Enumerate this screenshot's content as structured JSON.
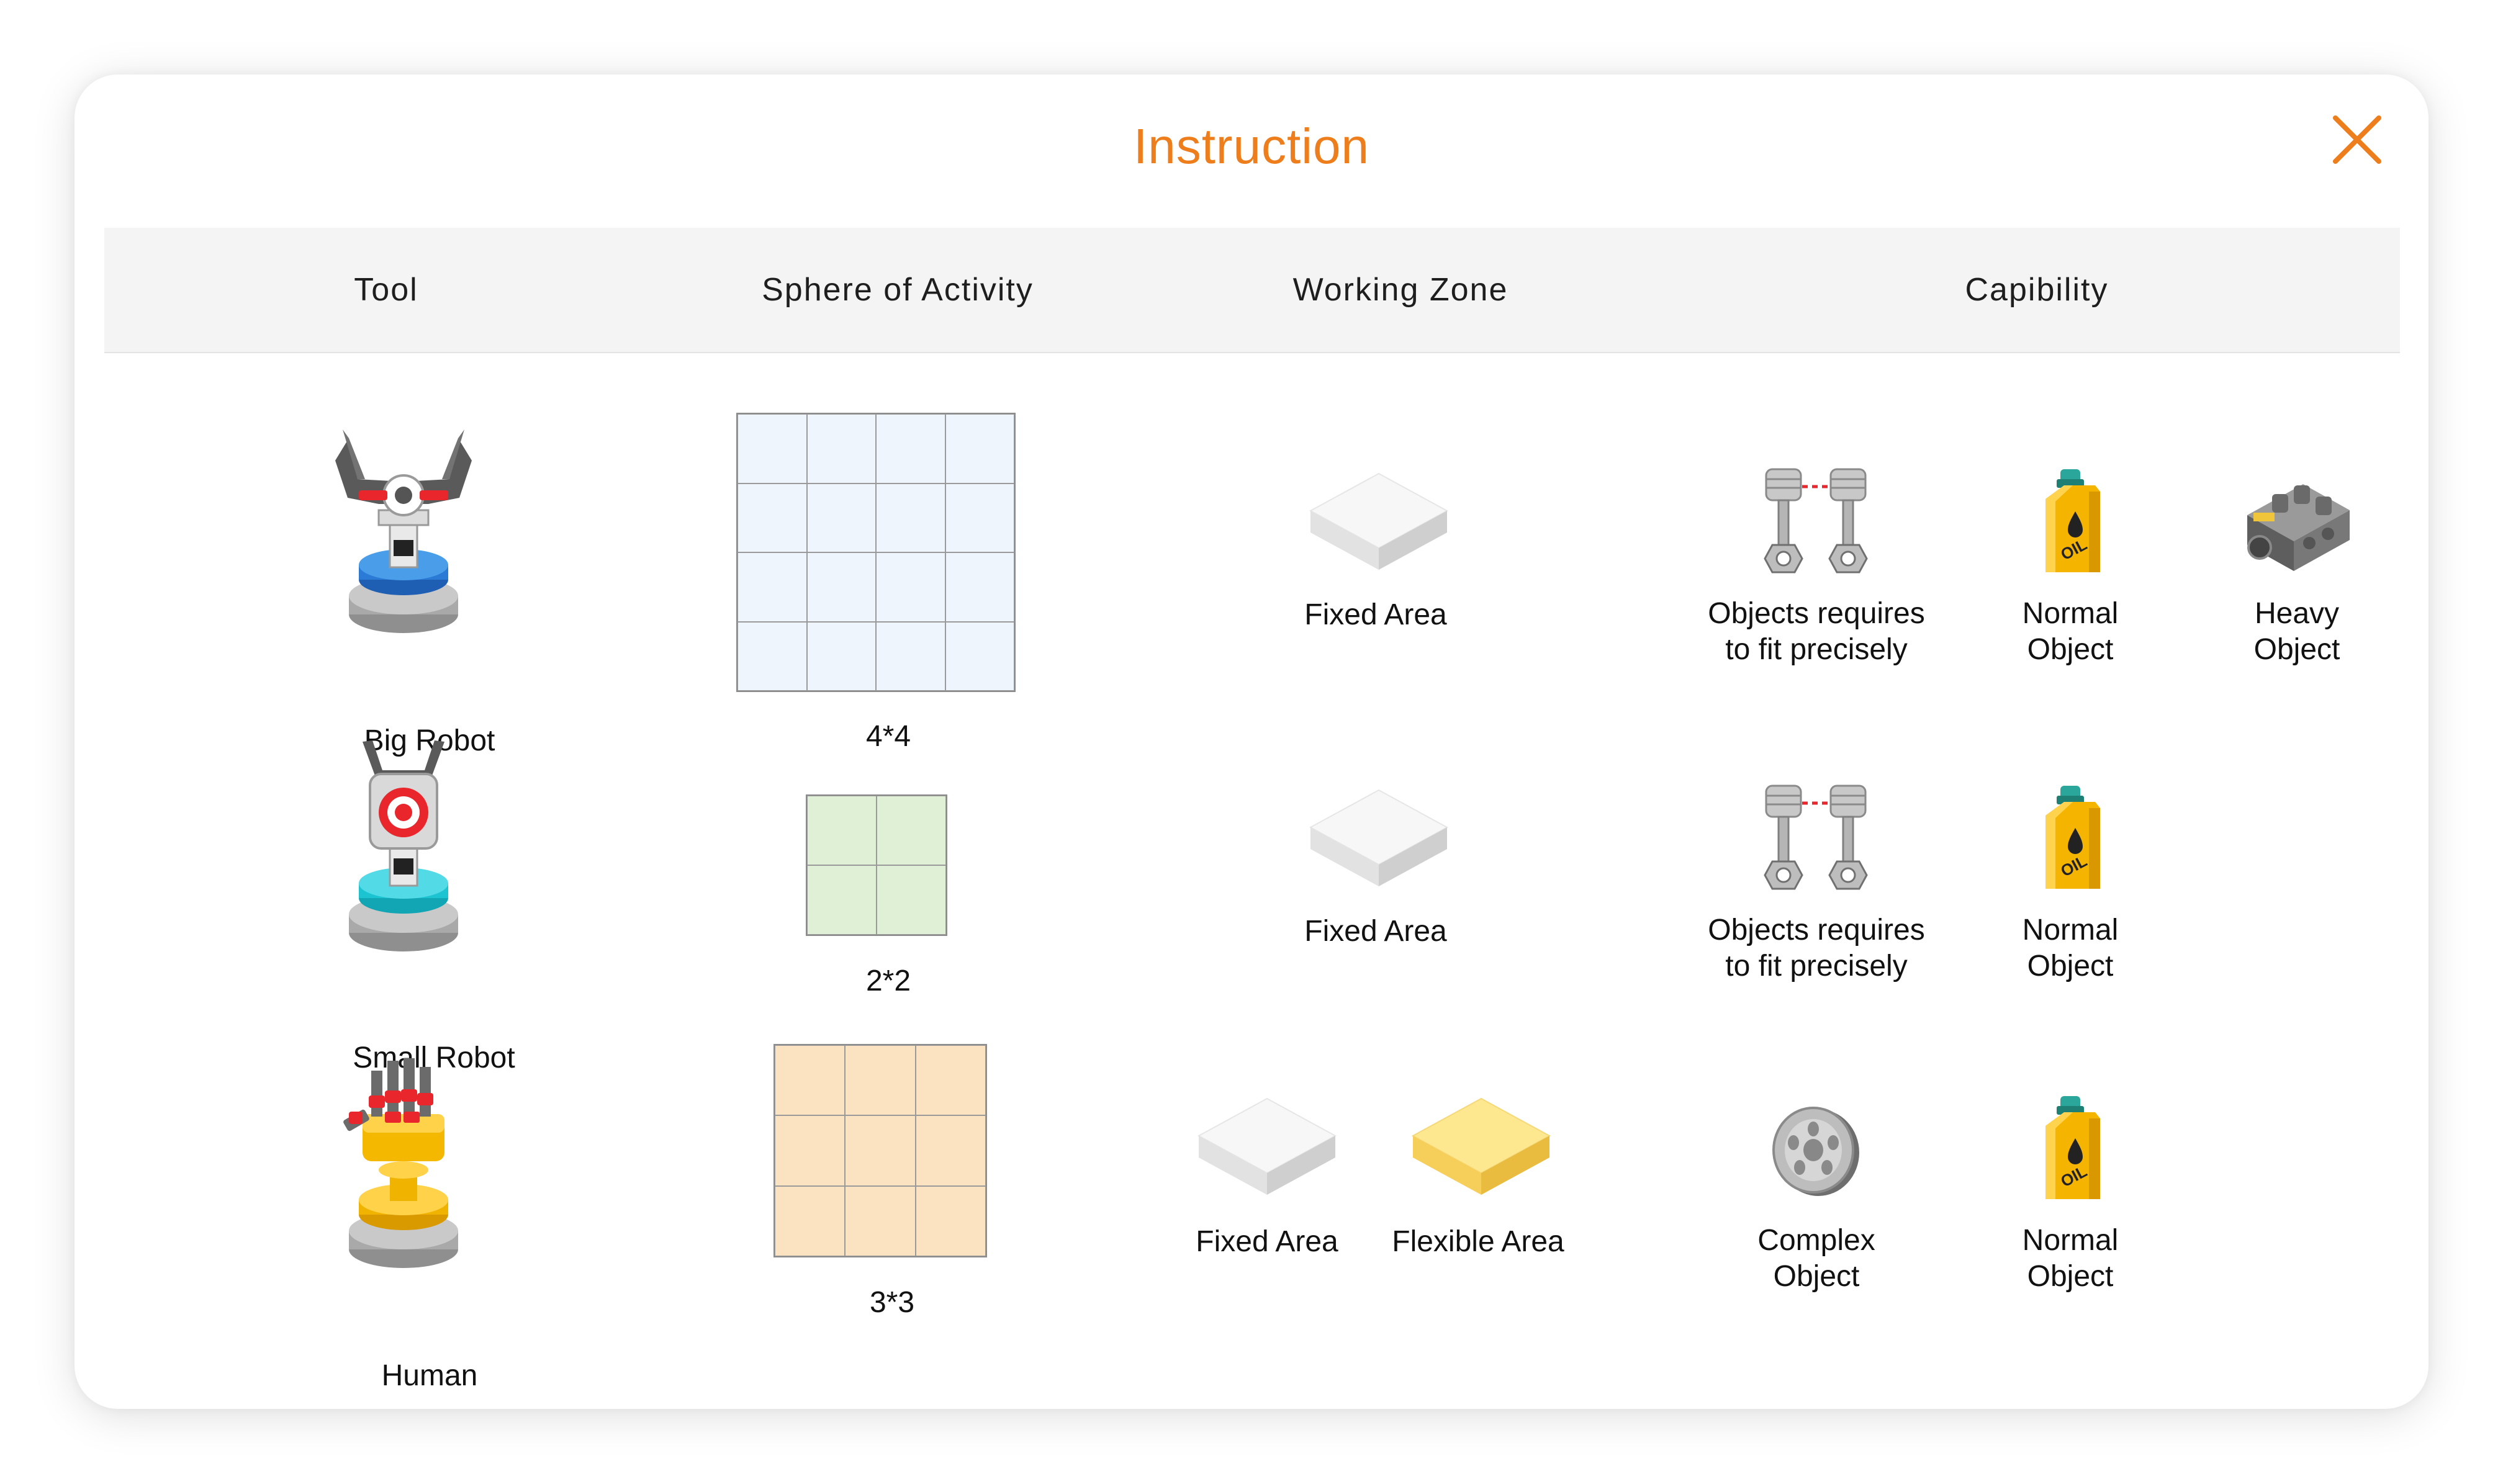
{
  "dialog": {
    "title": "Instruction",
    "accent_color": "#ee7d1c"
  },
  "columns": {
    "tool": "Tool",
    "sphere": "Sphere of Activity",
    "zone": "Working Zone",
    "capability": "Capibility"
  },
  "rows": [
    {
      "tool": {
        "name": "Big Robot",
        "icon": "big-robot-icon"
      },
      "sphere": {
        "label": "4*4",
        "color": "#eef5fc"
      },
      "zones": [
        {
          "label": "Fixed Area",
          "icon": "fixed-area-icon"
        }
      ],
      "capabilities": [
        {
          "line1": "Objects requires",
          "line2": "to fit precisely",
          "icon": "pistons-icon"
        },
        {
          "line1": "Normal",
          "line2": "Object",
          "icon": "oil-can-icon"
        },
        {
          "line1": "Heavy",
          "line2": "Object",
          "icon": "engine-block-icon"
        }
      ]
    },
    {
      "tool": {
        "name": "Small Robot",
        "icon": "small-robot-icon"
      },
      "sphere": {
        "label": "2*2",
        "color": "#dff0d6"
      },
      "zones": [
        {
          "label": "Fixed Area",
          "icon": "fixed-area-icon"
        }
      ],
      "capabilities": [
        {
          "line1": "Objects requires",
          "line2": "to fit precisely",
          "icon": "pistons-icon"
        },
        {
          "line1": "Normal",
          "line2": "Object",
          "icon": "oil-can-icon"
        }
      ]
    },
    {
      "tool": {
        "name": "Human",
        "icon": "human-hand-icon"
      },
      "sphere": {
        "label": "3*3",
        "color": "#fbe3c1"
      },
      "zones": [
        {
          "label": "Fixed Area",
          "icon": "fixed-area-icon"
        },
        {
          "label": "Flexible Area",
          "icon": "flexible-area-icon"
        }
      ],
      "capabilities": [
        {
          "line1": "Complex",
          "line2": "Object",
          "icon": "wheel-icon"
        },
        {
          "line1": "Normal",
          "line2": "Object",
          "icon": "oil-can-icon"
        }
      ]
    }
  ]
}
